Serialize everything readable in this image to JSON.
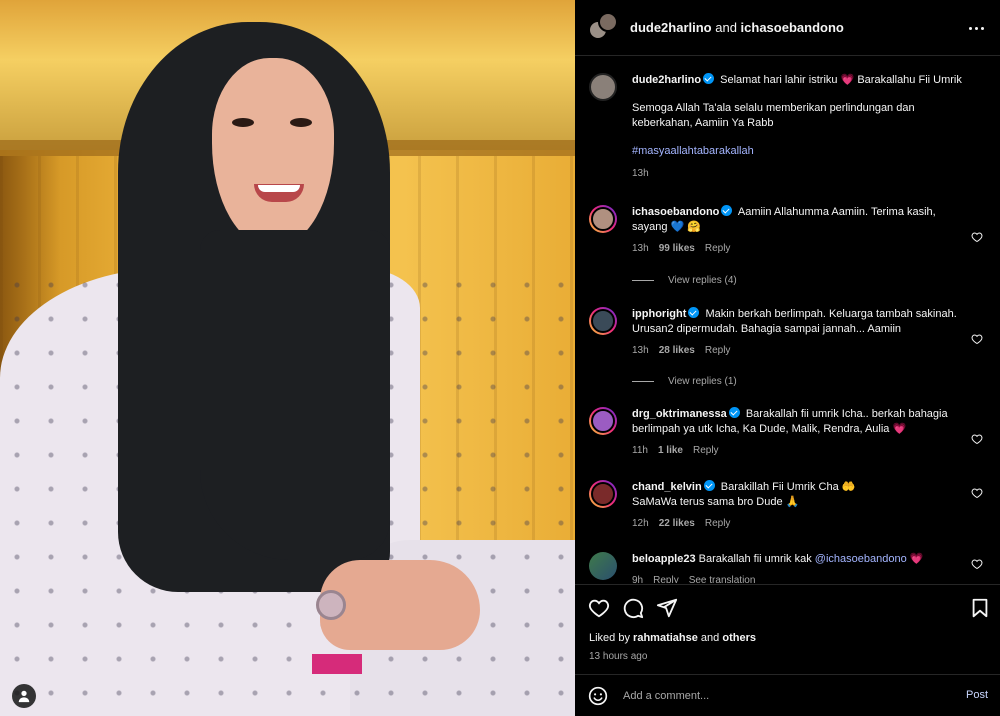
{
  "header": {
    "user1": "dude2harlino",
    "and": " and ",
    "user2": "ichasoebandono",
    "more_icon": "more-horizontal-icon"
  },
  "caption": {
    "username": "dude2harlino",
    "text1": "Selamat hari lahir istriku",
    "heart": "💗",
    "text2": "Barakallahu Fii Umrik",
    "paragraph": "Semoga Allah Ta'ala selalu memberikan perlindungan dan keberkahan, Aamiin Ya Rabb",
    "hashtag": "#masyaallahtabarakallah",
    "time": "13h"
  },
  "comments": [
    {
      "username": "ichasoebandono",
      "text": "Aamiin Allahumma Aamiin. Terima kasih, sayang",
      "emoji1": "💙",
      "emoji2": "🤗",
      "time": "13h",
      "likes": "99 likes",
      "reply": "Reply",
      "view_replies": "View replies (4)"
    },
    {
      "username": "ipphoright",
      "text": "Makin berkah berlimpah. Keluarga tambah sakinah. Urusan2 dipermudah. Bahagia sampai jannah... Aamiin",
      "time": "13h",
      "likes": "28 likes",
      "reply": "Reply",
      "view_replies": "View replies (1)"
    },
    {
      "username": "drg_oktrimanessa",
      "text": "Barakallah fii umrik Icha.. berkah bahagia berlimpah ya utk Icha, Ka Dude, Malik, Rendra, Aulia",
      "emoji1": "💗",
      "time": "11h",
      "likes": "1 like",
      "reply": "Reply"
    },
    {
      "username": "chand_kelvin",
      "text": "Barakillah Fii Umrik Cha",
      "emoji1": "🤲",
      "text2": "SaMaWa terus sama bro Dude",
      "emoji2": "🙏",
      "time": "12h",
      "likes": "22 likes",
      "reply": "Reply"
    },
    {
      "username": "beloapple23",
      "text": "Barakallah fii umrik kak",
      "mention": "@ichasoebandono",
      "emoji1": "💗",
      "time": "9h",
      "reply": "Reply",
      "translation": "See translation"
    }
  ],
  "actions": {
    "like_icon": "heart-outline-icon",
    "comment_icon": "comment-icon",
    "share_icon": "share-icon",
    "save_icon": "bookmark-icon",
    "liked_prefix": "Liked by",
    "liked_user": "rahmatiahse",
    "liked_and": "and",
    "liked_others": "others",
    "ago": "13 hours ago"
  },
  "composer": {
    "placeholder": "Add a comment...",
    "post": "Post",
    "emoji_icon": "smiley-icon"
  },
  "colors": {
    "background": "#000000",
    "verified": "#0095f6",
    "link": "#a4b5ff",
    "muted": "#a8a8a8"
  }
}
